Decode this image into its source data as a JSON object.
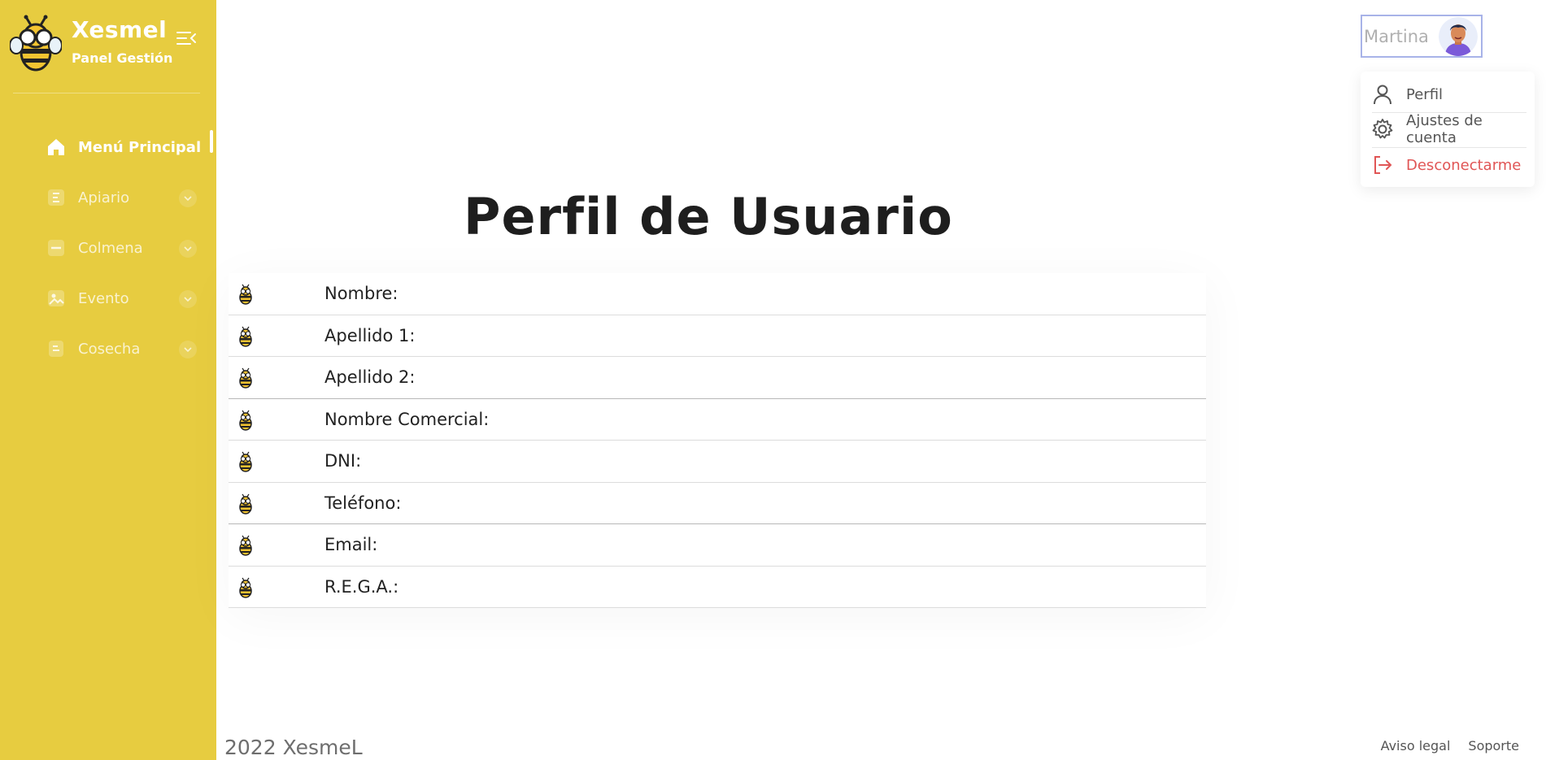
{
  "brand": {
    "title": "Xesmel",
    "subtitle": "Panel Gestión"
  },
  "nav": [
    {
      "label": "Menú Principal",
      "icon": "home-icon",
      "active": true
    },
    {
      "label": "Apiario",
      "icon": "list-icon"
    },
    {
      "label": "Colmena",
      "icon": "folder-icon"
    },
    {
      "label": "Evento",
      "icon": "image-icon"
    },
    {
      "label": "Cosecha",
      "icon": "document-icon"
    }
  ],
  "user": {
    "name": "Martina"
  },
  "user_menu": [
    {
      "label": "Perfil",
      "icon": "user-icon"
    },
    {
      "label": "Ajustes de cuenta",
      "icon": "gear-icon"
    },
    {
      "label": "Desconectarme",
      "icon": "logout-icon"
    }
  ],
  "page": {
    "title": "Perfil de Usuario"
  },
  "profile_fields": [
    {
      "label": "Nombre:"
    },
    {
      "label": "Apellido 1:"
    },
    {
      "label": "Apellido 2:"
    },
    {
      "label": "Nombre Comercial:"
    },
    {
      "label": "DNI:"
    },
    {
      "label": "Teléfono:"
    },
    {
      "label": "Email:"
    },
    {
      "label": "R.E.G.A.:"
    }
  ],
  "footer": {
    "copyright": "2022 XesmeL",
    "links": [
      "Aviso legal",
      "Soporte"
    ]
  },
  "colors": {
    "sidebar": "#e7cc40",
    "logout": "#e05555",
    "accent": "#a8b3e8"
  }
}
